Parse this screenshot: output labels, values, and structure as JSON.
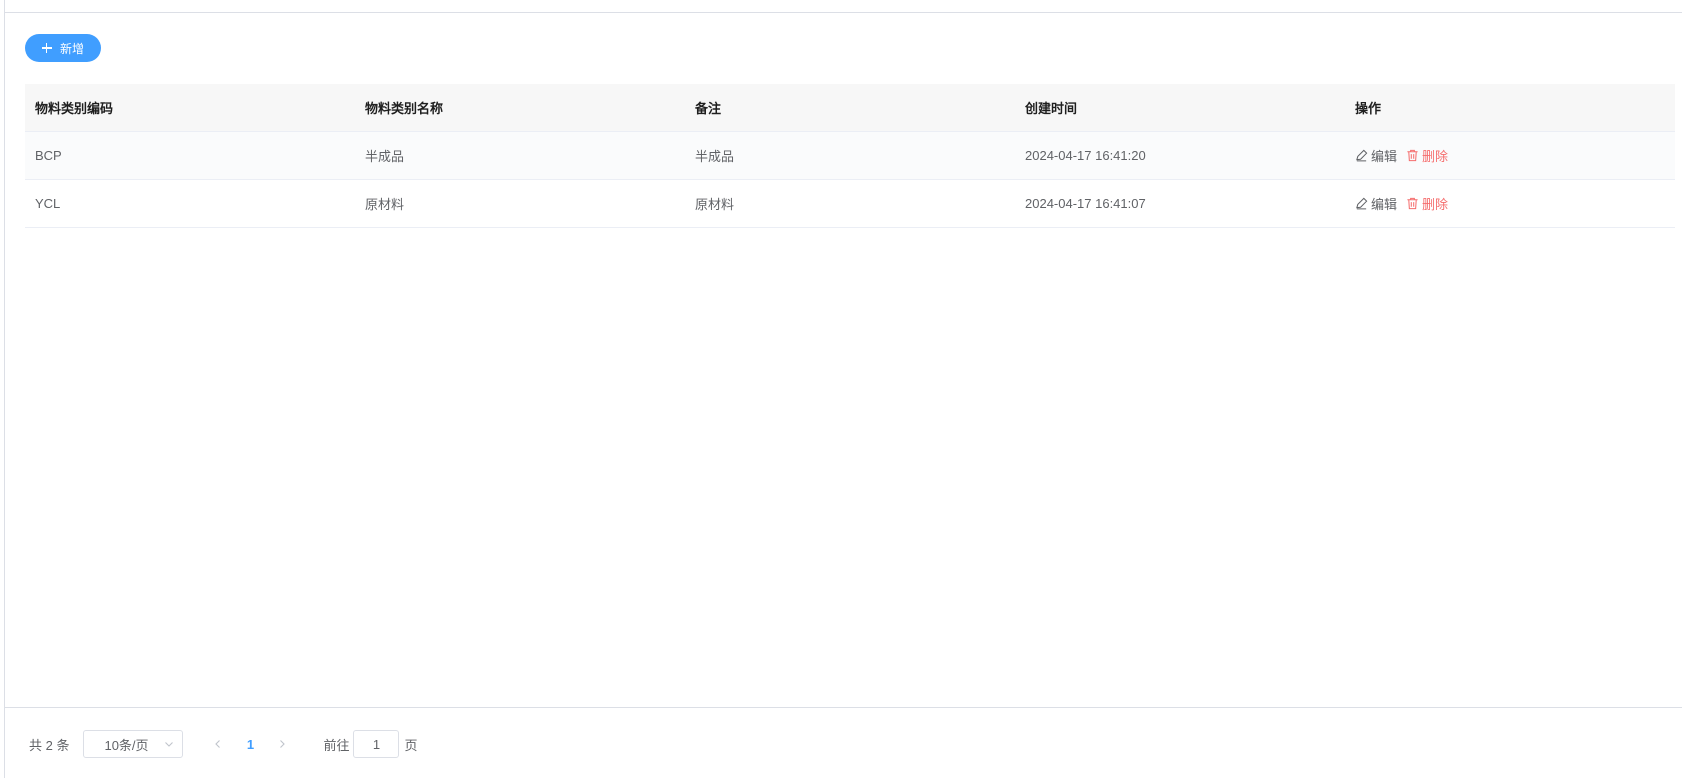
{
  "toolbar": {
    "add_label": "新增"
  },
  "table": {
    "columns": [
      "物料类别编码",
      "物料类别名称",
      "备注",
      "创建时间",
      "操作"
    ],
    "rows": [
      {
        "code": "BCP",
        "name": "半成品",
        "remark": "半成品",
        "created": "2024-04-17 16:41:20"
      },
      {
        "code": "YCL",
        "name": "原材料",
        "remark": "原材料",
        "created": "2024-04-17 16:41:07"
      }
    ],
    "edit_label": "编辑",
    "delete_label": "删除"
  },
  "pagination": {
    "total_text": "共 2 条",
    "page_size": "10条/页",
    "current_page": "1",
    "goto_prefix": "前往",
    "goto_value": "1",
    "goto_suffix": "页"
  },
  "colors": {
    "primary": "#409eff",
    "danger": "#f56c6c",
    "text": "#606266"
  },
  "icons": [
    "plus-icon",
    "edit-icon",
    "delete-icon",
    "chevron-down-icon",
    "chevron-left-icon",
    "chevron-right-icon"
  ]
}
